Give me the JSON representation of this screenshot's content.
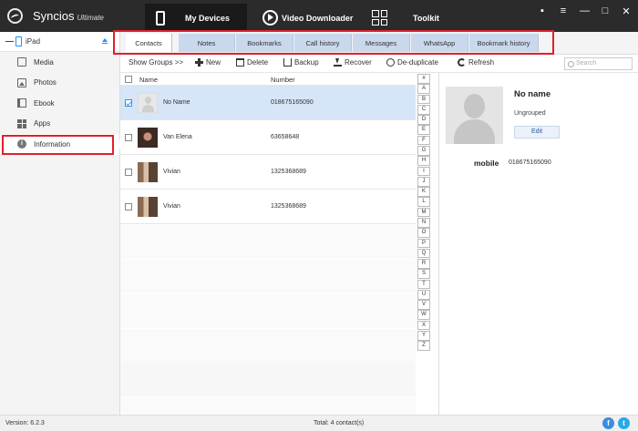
{
  "app": {
    "name": "Syncios",
    "edition": "Ultimate"
  },
  "nav": {
    "devices": "My Devices",
    "video": "Video Downloader",
    "toolkit": "Toolkit"
  },
  "window_controls": {
    "chat": "▪",
    "menu": "≡",
    "minimize": "—",
    "maximize": "□",
    "close": "✕"
  },
  "device": {
    "name": "iPad"
  },
  "sidebar": {
    "items": [
      {
        "label": "Media"
      },
      {
        "label": "Photos"
      },
      {
        "label": "Ebook"
      },
      {
        "label": "Apps"
      },
      {
        "label": "Information",
        "selected": true
      }
    ]
  },
  "tabs": [
    {
      "label": "Contacts",
      "active": true
    },
    {
      "label": "Notes"
    },
    {
      "label": "Bookmarks"
    },
    {
      "label": "Call history"
    },
    {
      "label": "Messages"
    },
    {
      "label": "WhatsApp"
    },
    {
      "label": "Bookmark history"
    }
  ],
  "toolbar": {
    "show_groups": "Show Groups >>",
    "new": "New",
    "delete": "Delete",
    "backup": "Backup",
    "recover": "Recover",
    "dedup": "De-duplicate",
    "refresh": "Refresh",
    "search_placeholder": "Search"
  },
  "list": {
    "col_name": "Name",
    "col_number": "Number",
    "contacts": [
      {
        "name": "No Name",
        "number": "018675165090",
        "checked": true,
        "selected": true
      },
      {
        "name": "Van Elena",
        "number": "63658648",
        "checked": false
      },
      {
        "name": "Vivian",
        "number": "1325368689",
        "checked": false
      },
      {
        "name": "Vivian",
        "number": "1325368689",
        "checked": false
      }
    ]
  },
  "alphabet": [
    "#",
    "A",
    "B",
    "C",
    "D",
    "E",
    "F",
    "G",
    "H",
    "I",
    "J",
    "K",
    "L",
    "M",
    "N",
    "O",
    "P",
    "Q",
    "R",
    "S",
    "T",
    "U",
    "V",
    "W",
    "X",
    "Y",
    "Z"
  ],
  "detail": {
    "name": "No name",
    "group": "Ungrouped",
    "edit": "Edit",
    "field_label": "mobile",
    "field_value": "018675165090"
  },
  "status": {
    "version": "Version: 6.2.3",
    "total": "Total: 4 contact(s)"
  },
  "colors": {
    "titlebar": "#2b2b2b",
    "tab_inactive": "#c9d8ec",
    "selected_row": "#d6e5f7",
    "highlight_box": "#e0202c"
  }
}
